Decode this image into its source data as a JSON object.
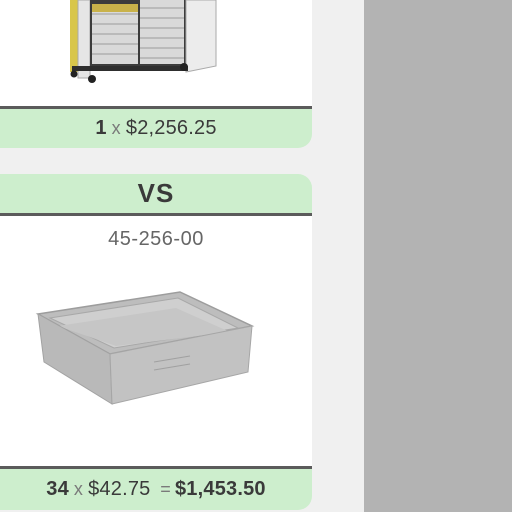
{
  "item1": {
    "qty": "1",
    "times": "x",
    "unit_price": "$2,256.25",
    "image_icon": "storage-cabinet-icon"
  },
  "divider": {
    "label": "VS"
  },
  "item2": {
    "sku": "45-256-00",
    "qty": "34",
    "times": "x",
    "unit_price": "$42.75",
    "equals": "=",
    "total": "$1,453.50",
    "image_icon": "plastic-tray-icon"
  },
  "colors": {
    "pill_bg": "#cdeecd",
    "divider_line": "#5b5b5b",
    "side_panel": "#b3b3b3"
  }
}
